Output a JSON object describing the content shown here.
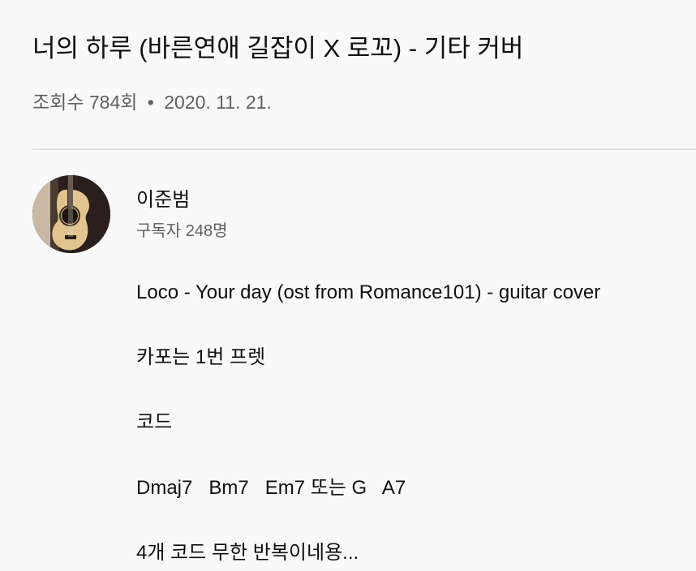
{
  "video": {
    "title": "너의 하루 (바른연애 길잡이 X 로꼬) - 기타 커버",
    "views": "조회수 784회",
    "separator": "•",
    "date": "2020. 11. 21."
  },
  "channel": {
    "name": "이준범",
    "subscribers": "구독자 248명",
    "avatar_icon": "guitar-avatar-icon"
  },
  "description": {
    "lines": [
      "Loco - Your day (ost from Romance101) - guitar cover",
      "카포는 1번 프렛",
      "코드",
      "Dmaj7   Bm7   Em7 또는 G   A7",
      "4개 코드 무한 반복이네용..."
    ]
  }
}
